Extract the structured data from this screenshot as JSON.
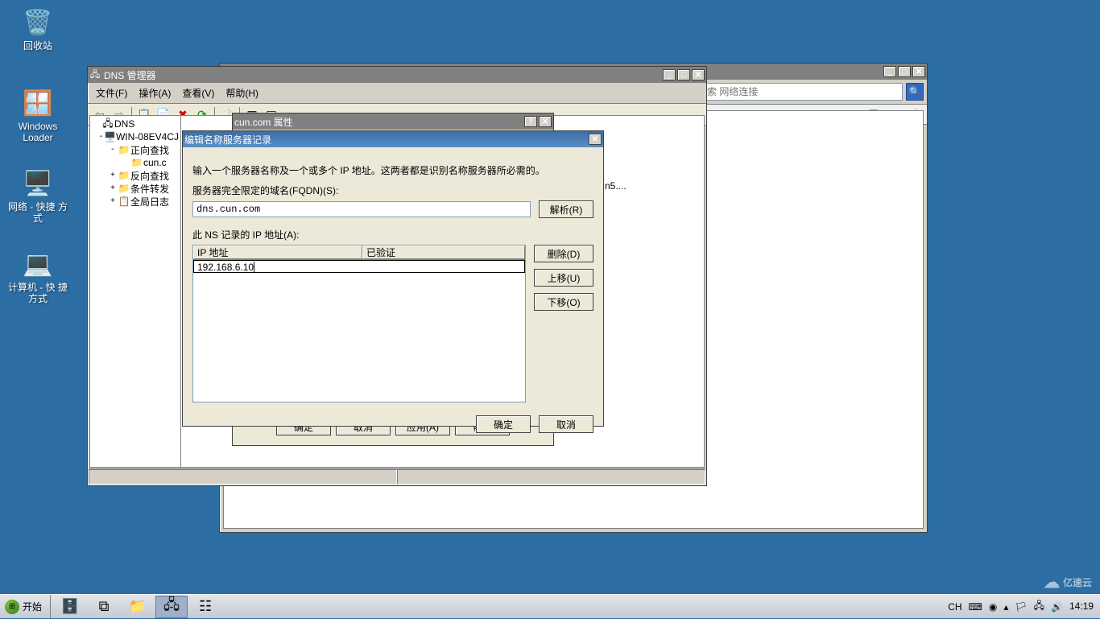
{
  "desktop": {
    "icons": [
      {
        "name": "recycle-bin",
        "label": "回收站",
        "glyph": "🗑️"
      },
      {
        "name": "windows-loader",
        "label": "Windows\nLoader",
        "glyph": "🪟"
      },
      {
        "name": "network-shortcut",
        "label": "网络 - 快捷\n方式",
        "glyph": "🖥️"
      },
      {
        "name": "computer-shortcut",
        "label": "计算机 - 快\n捷方式",
        "glyph": "💻"
      }
    ]
  },
  "search_window": {
    "placeholder": "搜索 网络连接",
    "toolbar_icons": [
      "view-icon",
      "dropdown-icon",
      "pane-icon",
      "help-icon"
    ]
  },
  "dns_window": {
    "title": "DNS 管理器",
    "menu": [
      "文件(F)",
      "操作(A)",
      "查看(V)",
      "帮助(H)"
    ],
    "tree": {
      "root": "DNS",
      "server": "WIN-08EV4CJ",
      "nodes": [
        {
          "label": "正向查找",
          "icon": "📁",
          "expand": "-"
        },
        {
          "label": "cun.c",
          "icon": "📁",
          "expand": "",
          "indent": 1,
          "sel": true
        },
        {
          "label": "反向查找",
          "icon": "📁",
          "expand": "+"
        },
        {
          "label": "条件转发",
          "icon": "📁",
          "expand": "+"
        },
        {
          "label": "全局日志",
          "icon": "📋",
          "expand": "+"
        }
      ]
    },
    "detail_hint": "n5...."
  },
  "prop_dialog": {
    "title": "cun.com 属性",
    "buttons": {
      "ok": "确定",
      "cancel": "取消",
      "apply": "应用(A)",
      "help": "帮助"
    }
  },
  "edit_dialog": {
    "title": "编辑名称服务器记录",
    "instruction": "输入一个服务器名称及一个或多个 IP 地址。这两者都是识别名称服务器所必需的。",
    "fqdn_label": "服务器完全限定的域名(FQDN)(S):",
    "fqdn_value": "dns.cun.com",
    "resolve": "解析(R)",
    "ip_list_label": "此 NS 记录的 IP 地址(A):",
    "columns": {
      "ip": "IP 地址",
      "verified": "已验证"
    },
    "ip_value": "192.168.6.10",
    "buttons": {
      "delete": "删除(D)",
      "up": "上移(U)",
      "down": "下移(O)",
      "ok": "确定",
      "cancel": "取消"
    }
  },
  "taskbar": {
    "start": "开始",
    "tray": {
      "lang": "CH",
      "time": "14:19"
    }
  },
  "watermark": "亿速云"
}
